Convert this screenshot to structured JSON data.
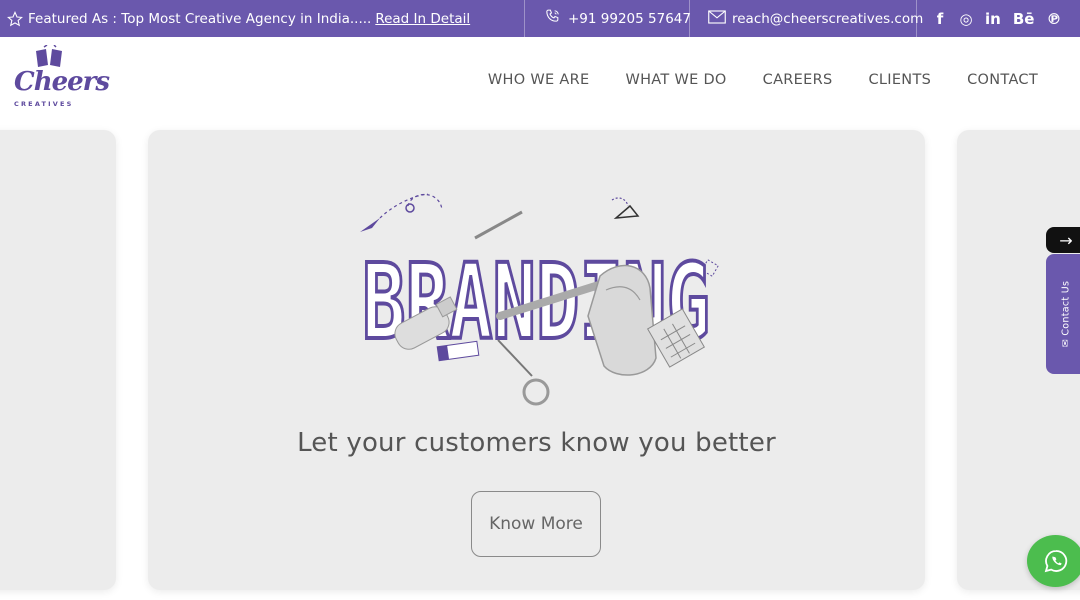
{
  "topbar": {
    "featured_text": "Featured As : Top Most Creative Agency in India.....",
    "read_link": "Read In Detail",
    "phone": "+91 99205 57647",
    "email": "reach@cheerscreatives.com",
    "social_icons": [
      "facebook-icon",
      "instagram-icon",
      "linkedin-icon",
      "behance-icon",
      "pinterest-icon"
    ],
    "social_glyphs": [
      "f",
      "◎",
      "in",
      "Bē",
      "℗"
    ]
  },
  "logo": {
    "word": "Cheers",
    "sub": "CREATIVES"
  },
  "nav": {
    "items": [
      "WHO WE ARE",
      "WHAT WE DO",
      "CAREERS",
      "CLIENTS",
      "CONTACT"
    ]
  },
  "slide": {
    "illustration_word": "BRANDING",
    "tagline": "Let your customers know you better",
    "button": "Know More"
  },
  "side": {
    "arrow": "→",
    "contact_tab": "Contact Us"
  },
  "colors": {
    "brand_purple": "#6a58ad",
    "whatsapp_green": "#4cbd4e",
    "card_bg": "#ececec"
  }
}
